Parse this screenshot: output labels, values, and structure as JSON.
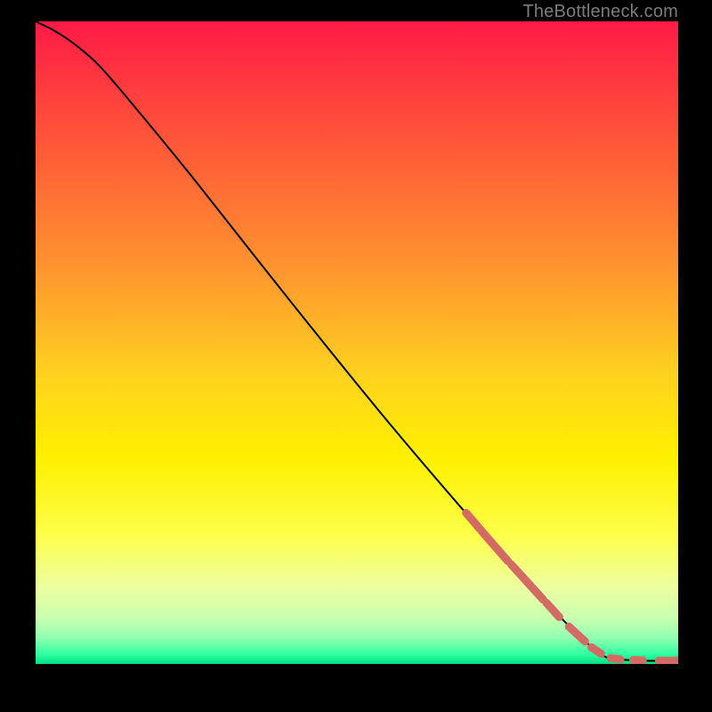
{
  "attribution": "TheBottleneck.com",
  "chart_data": {
    "type": "line",
    "title": "",
    "xlabel": "",
    "ylabel": "",
    "xlim": [
      0,
      100
    ],
    "ylim": [
      0,
      100
    ],
    "curve": [
      {
        "x": 0,
        "y": 100
      },
      {
        "x": 3,
        "y": 98.5
      },
      {
        "x": 6,
        "y": 96.5
      },
      {
        "x": 10,
        "y": 93
      },
      {
        "x": 16,
        "y": 86
      },
      {
        "x": 25,
        "y": 75
      },
      {
        "x": 40,
        "y": 56
      },
      {
        "x": 55,
        "y": 37.5
      },
      {
        "x": 70,
        "y": 20
      },
      {
        "x": 80,
        "y": 9
      },
      {
        "x": 85,
        "y": 4
      },
      {
        "x": 88,
        "y": 1.5
      },
      {
        "x": 90,
        "y": 0.8
      },
      {
        "x": 95,
        "y": 0.5
      },
      {
        "x": 100,
        "y": 0.5
      }
    ],
    "highlight_segments": [
      {
        "x1": 67,
        "y1": 23.5,
        "x2": 70,
        "y2": 20
      },
      {
        "x1": 70,
        "y1": 20,
        "x2": 73.5,
        "y2": 16
      },
      {
        "x1": 74,
        "y1": 15.5,
        "x2": 79,
        "y2": 10
      },
      {
        "x1": 79.5,
        "y1": 9.5,
        "x2": 81.5,
        "y2": 7.3
      },
      {
        "x1": 83,
        "y1": 5.8,
        "x2": 85.5,
        "y2": 3.5
      },
      {
        "x1": 86.5,
        "y1": 2.6,
        "x2": 88,
        "y2": 1.6
      },
      {
        "x1": 89.5,
        "y1": 0.9,
        "x2": 91,
        "y2": 0.7
      },
      {
        "x1": 93,
        "y1": 0.6,
        "x2": 94.5,
        "y2": 0.55
      },
      {
        "x1": 97,
        "y1": 0.5,
        "x2": 98.5,
        "y2": 0.5
      },
      {
        "x1": 99,
        "y1": 0.5,
        "x2": 100,
        "y2": 0.5
      }
    ],
    "gradient_stops": [
      {
        "offset": 0.0,
        "color": "#ff1a46"
      },
      {
        "offset": 0.1,
        "color": "#ff3b3f"
      },
      {
        "offset": 0.25,
        "color": "#ff6a35"
      },
      {
        "offset": 0.4,
        "color": "#ff9a2e"
      },
      {
        "offset": 0.55,
        "color": "#ffd21f"
      },
      {
        "offset": 0.68,
        "color": "#fff000"
      },
      {
        "offset": 0.8,
        "color": "#fdff4a"
      },
      {
        "offset": 0.88,
        "color": "#edffa0"
      },
      {
        "offset": 0.93,
        "color": "#c7ffb0"
      },
      {
        "offset": 0.96,
        "color": "#8fffb0"
      },
      {
        "offset": 0.985,
        "color": "#2fffa0"
      },
      {
        "offset": 1.0,
        "color": "#00e082"
      }
    ],
    "colors": {
      "curve": "#000000",
      "highlight": "#d36a64"
    }
  }
}
